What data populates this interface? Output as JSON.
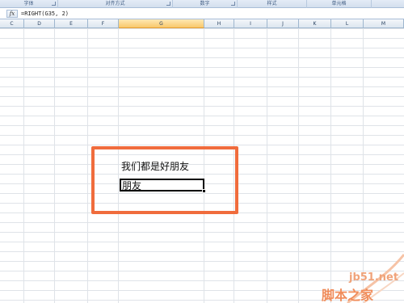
{
  "ribbon": {
    "groups": [
      {
        "label": "字体"
      },
      {
        "label": "对齐方式"
      },
      {
        "label": "数字"
      },
      {
        "label": "样式"
      },
      {
        "label": "单元格"
      }
    ]
  },
  "formula_bar": {
    "fx_label": "fx",
    "formula": "=RIGHT(G35, 2)"
  },
  "columns": [
    "C",
    "D",
    "E",
    "F",
    "G",
    "H",
    "I",
    "J",
    "K",
    "L",
    "M"
  ],
  "active_column": "G",
  "cells": {
    "source_text": "我们都是好朋友",
    "result_text": "朋友"
  },
  "watermark": {
    "site": "jb51.net",
    "name": "脚本之家"
  },
  "colors": {
    "highlight": "#f06c3d",
    "active_header": "#f8c76a",
    "gridline": "#dfe3e8"
  }
}
